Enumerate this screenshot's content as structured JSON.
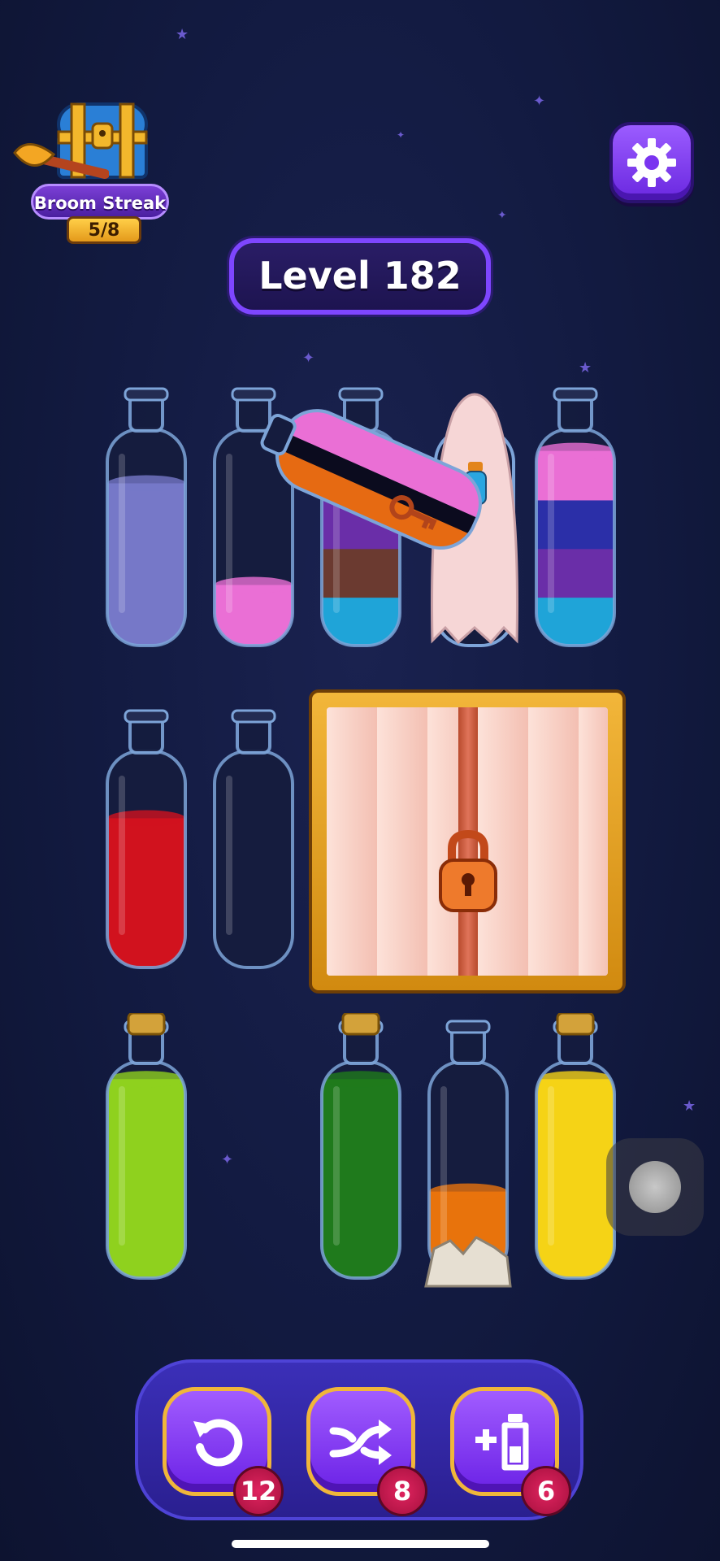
{
  "streak": {
    "title": "Broom Streak",
    "count": "5/8"
  },
  "level": {
    "label": "Level 182"
  },
  "icons": {
    "settings": "gear-icon",
    "undo": "undo-icon",
    "shuffle": "shuffle-icon",
    "add_tube": "add-bottle-icon",
    "lock": "padlock-icon",
    "key": "key-icon"
  },
  "tubes_row1": [
    {
      "layers": [
        "#7678c8"
      ],
      "fill": 0.75
    },
    {
      "layers": [
        "#ea6fd5"
      ],
      "fill": 0.28
    },
    {
      "layers": [
        "#1fa4d8",
        "#6b3a30",
        "#6a2ea8",
        "#ea6fd5"
      ],
      "fill": 0.9,
      "partly_hidden": true
    },
    {
      "hidden": true,
      "veil": "ghost",
      "note_icon": "potion-icon"
    },
    {
      "layers": [
        "#1fa4d8",
        "#6a2ea8",
        "#2b2fa8",
        "#ea6fd5"
      ],
      "fill": 0.9
    }
  ],
  "pouring_tube": {
    "layers": [
      "#ea6fd5",
      "#0b0b1e",
      "#e66a12"
    ],
    "has_key": true
  },
  "tubes_row2": [
    {
      "layers": [
        "#d1121e"
      ],
      "fill": 0.69
    },
    {
      "layers": [],
      "fill": 0
    }
  ],
  "cabinet": {
    "locked": true
  },
  "tubes_row3": [
    {
      "layers": [
        "#8fd11e"
      ],
      "fill": 0.92,
      "corked": true
    },
    {
      "empty_slot": true
    },
    {
      "layers": [
        "#1f7a1c"
      ],
      "fill": 0.92,
      "corked": true
    },
    {
      "layers": [
        "#e8730c"
      ],
      "fill": 0.4,
      "blocked_by": "rocks"
    },
    {
      "layers": [
        "#f5d316"
      ],
      "fill": 0.92,
      "corked": true
    }
  ],
  "tools": [
    {
      "name": "undo",
      "count": "12"
    },
    {
      "name": "shuffle",
      "count": "8"
    },
    {
      "name": "add_tube",
      "count": "6"
    }
  ]
}
